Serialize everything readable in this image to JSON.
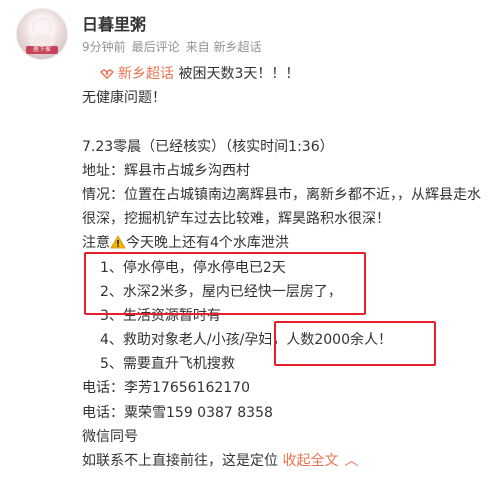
{
  "post": {
    "author": "日暮里粥",
    "avatar_badge": "居下家",
    "meta": {
      "time": "9分钟前",
      "last_comment": "最后评论",
      "source": "来自 新乡超话"
    },
    "topic": "新乡超话",
    "lines": {
      "l1_rest": "被困天数3天！！！",
      "l2": "无健康问题！",
      "l4": "7.23零晨（已经核实）（核实时间1:36）",
      "l5": "地址：辉县市占城乡沟西村",
      "l6": "情况：位置在占城镇南边离辉县市，离新乡都不近，，从辉县走水",
      "l7": "很深，挖掘机铲车过去比较难，辉昊路积水很深！",
      "l8_pre": "注意",
      "l8_post": "今天晚上还有4个水库泄洪",
      "i1": "1、停水停电，停水停电已2天",
      "i2": "2、水深2米多，屋内已经快一层房了，",
      "i3": "3、生活资源暂时有",
      "i4a": "4、救助对象老人/小孩/孕妇，",
      "i4b": "人数2000余人！",
      "i5": "5、需要直升飞机搜救",
      "c1": "电话：李芳17656162170",
      "c2": "电话：粟荣雪159 0387 8358",
      "c3": "微信同号",
      "c4": "如联系不上直接前往，这是定位",
      "collapse": "收起全文",
      "collapse_icon": "chevron-up-icon"
    }
  },
  "colors": {
    "accent": "#eb7350",
    "highlight_box": "#e4202a",
    "meta_gray": "#939393",
    "warning_yellow": "#f5b800"
  }
}
